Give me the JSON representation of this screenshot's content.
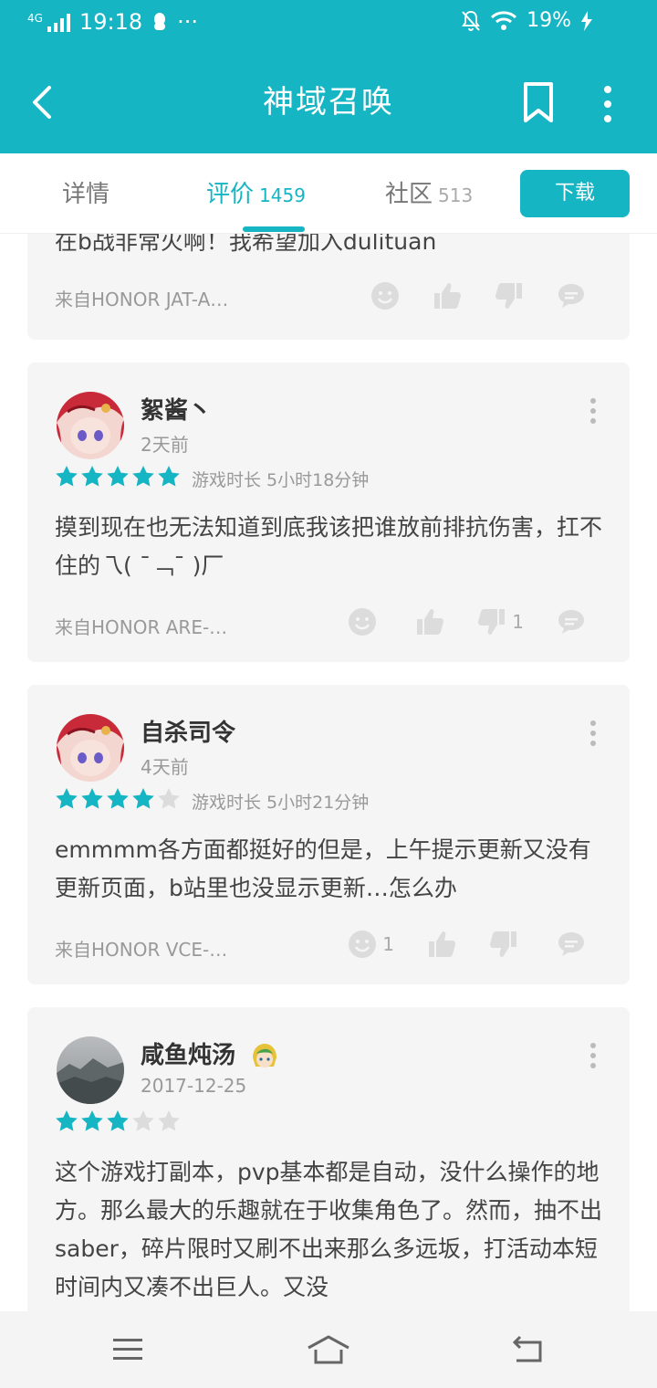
{
  "status_bar": {
    "network": "4G",
    "time": "19:18",
    "dots": "···",
    "battery": "19%"
  },
  "app_bar": {
    "title": "神域召唤"
  },
  "tabs": [
    {
      "label": "详情",
      "count": ""
    },
    {
      "label": "评价",
      "count": "1459"
    },
    {
      "label": "社区",
      "count": "513"
    }
  ],
  "download_label": "下载",
  "partial_review": {
    "text": "在b战非常火啊！我希望加入dulituan",
    "device": "来自HONOR JAT-A…"
  },
  "reviews": [
    {
      "user": "絮酱丶",
      "date": "2天前",
      "rating": 5,
      "playtime": "游戏时长 5小时18分钟",
      "text": "摸到现在也无法知道到底我该把谁放前排抗伤害，扛不住的乁( ˉ﹁ˉ )厂",
      "device": "来自HONOR ARE-…",
      "smile_count": "",
      "dislike_count": "1"
    },
    {
      "user": "自杀司令",
      "date": "4天前",
      "rating": 4,
      "playtime": "游戏时长 5小时21分钟",
      "text": "emmmm各方面都挺好的但是，上午提示更新又没有更新页面，b站里也没显示更新…怎么办",
      "device": "来自HONOR VCE-…",
      "smile_count": "1",
      "dislike_count": ""
    },
    {
      "user": "咸鱼炖汤",
      "date": "2017-12-25",
      "rating": 3,
      "playtime": "",
      "text": "这个游戏打副本，pvp基本都是自动，没什么操作的地方。那么最大的乐趣就在于收集角色了。然而，抽不出saber，碎片限时又刷不出来那么多远坂，打活动本短时间内又凑不出巨人。又没",
      "device": "",
      "smile_count": "",
      "dislike_count": ""
    }
  ],
  "colors": {
    "accent": "#16b5c4",
    "star_off": "#dcdcdc",
    "card_bg": "#f5f5f5"
  }
}
